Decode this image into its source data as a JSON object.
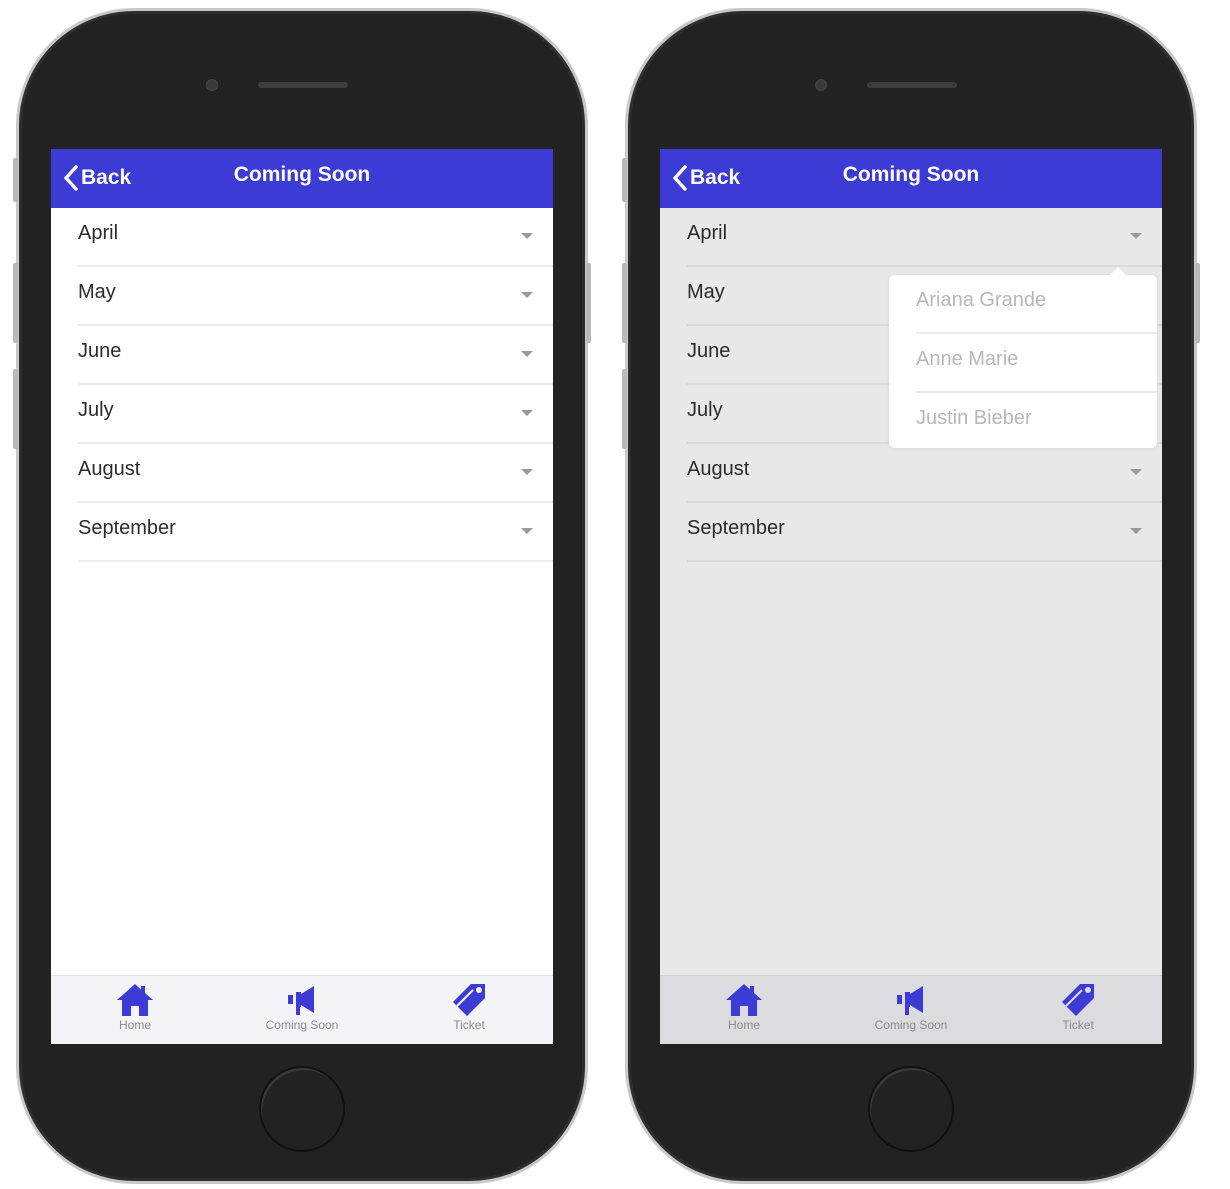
{
  "screens": [
    {
      "header": {
        "back_label": "Back",
        "title": "Coming Soon"
      },
      "months": [
        "April",
        "May",
        "June",
        "July",
        "August",
        "September"
      ],
      "tabs": [
        {
          "label": "Home",
          "icon": "home-icon"
        },
        {
          "label": "Coming Soon",
          "icon": "megaphone-icon"
        },
        {
          "label": "Ticket",
          "icon": "ticket-icon"
        }
      ]
    },
    {
      "header": {
        "back_label": "Back",
        "title": "Coming Soon"
      },
      "months": [
        "April",
        "May",
        "June",
        "July",
        "August",
        "September"
      ],
      "popover": {
        "items": [
          "Ariana Grande",
          "Anne Marie",
          "Justin Bieber"
        ]
      },
      "tabs": [
        {
          "label": "Home",
          "icon": "home-icon"
        },
        {
          "label": "Coming Soon",
          "icon": "megaphone-icon"
        },
        {
          "label": "Ticket",
          "icon": "ticket-icon"
        }
      ]
    }
  ],
  "colors": {
    "accent": "#3c3bd6",
    "phone_body": "#222222"
  }
}
